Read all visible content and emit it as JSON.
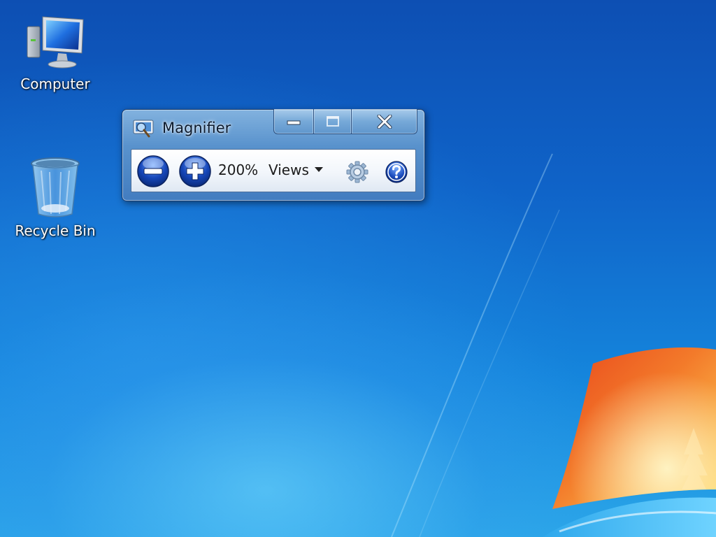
{
  "desktop": {
    "icons": [
      {
        "label": "Computer",
        "icon": "computer-monitor-icon"
      },
      {
        "label": "Recycle Bin",
        "icon": "recycle-bin-icon"
      }
    ]
  },
  "magnifier": {
    "title": "Magnifier",
    "app_icon": "magnifier-app-icon",
    "zoom_level": "200%",
    "views_label": "Views",
    "buttons": {
      "zoom_out": "zoom-out-icon",
      "zoom_in": "zoom-in-icon",
      "options": "gear-icon",
      "help": "help-icon"
    }
  },
  "colors": {
    "desktop_top": "#0d4fb3",
    "desktop_bottom": "#2aa6e8",
    "window_frame": "#6a9fd0",
    "button_blue": "#1646b8",
    "logo_orange": "#f15a22",
    "logo_yellow": "#ffd24a"
  }
}
